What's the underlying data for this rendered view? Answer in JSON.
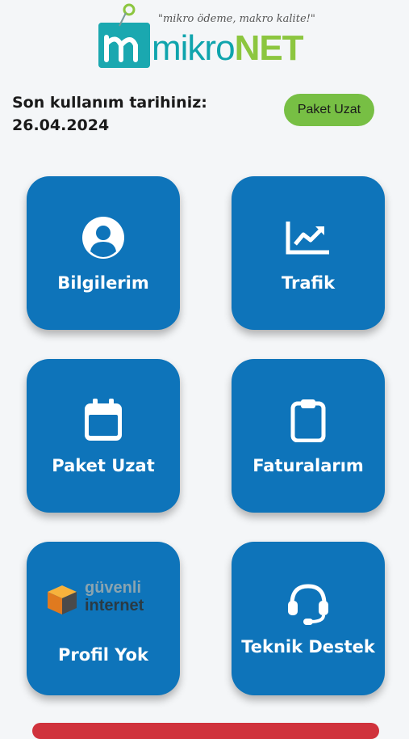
{
  "brand": {
    "tagline": "\"mikro ödeme, makro kalite!\"",
    "name_part1": "mikro",
    "name_part2": "NET"
  },
  "header": {
    "last_used_label": "Son kullanım tarihiniz:",
    "last_used_date": "26.04.2024",
    "extend_button": "Paket Uzat"
  },
  "tiles": [
    {
      "label": "Bilgilerim",
      "icon": "user-circle-icon"
    },
    {
      "label": "Trafik",
      "icon": "chart-line-icon"
    },
    {
      "label": "Paket Uzat",
      "icon": "calendar-icon"
    },
    {
      "label": "Faturalarım",
      "icon": "clipboard-icon"
    },
    {
      "label": "Profil Yok",
      "icon": "guvenli-internet-logo"
    },
    {
      "label": "Teknik Destek",
      "icon": "headset-icon"
    }
  ],
  "guvenli": {
    "line1": "güvenli",
    "line2": "internet"
  },
  "colors": {
    "tile": "#0e74ba",
    "accent_green": "#77bf44",
    "bottom_bar": "#d0323c"
  }
}
